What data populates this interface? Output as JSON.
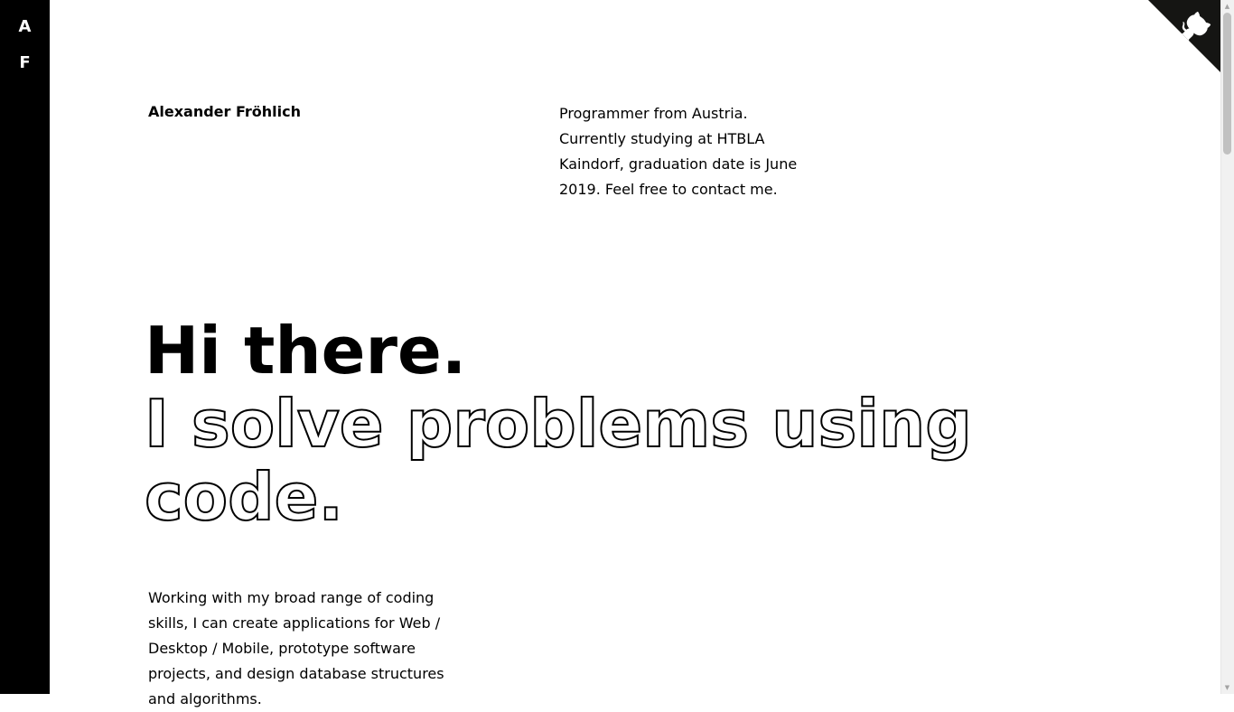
{
  "sidebar": {
    "logo_letters": [
      "A",
      "F"
    ]
  },
  "corner": {
    "icon": "github-octocat-icon",
    "background_color": "#151513"
  },
  "header": {
    "name": "Alexander Fröhlich",
    "bio": "Programmer from Austria. Currently studying at HTBLA Kaindorf, graduation date is June 2019. Feel free to contact me."
  },
  "hero": {
    "greeting": "Hi there.",
    "tagline": "I solve problems using code."
  },
  "about": {
    "text": "Working with my broad range of coding skills, I can create applications for Web / Desktop / Mobile, prototype software projects, and design database structures and algorithms."
  },
  "colors": {
    "accent": "#000000",
    "background": "#ffffff"
  }
}
